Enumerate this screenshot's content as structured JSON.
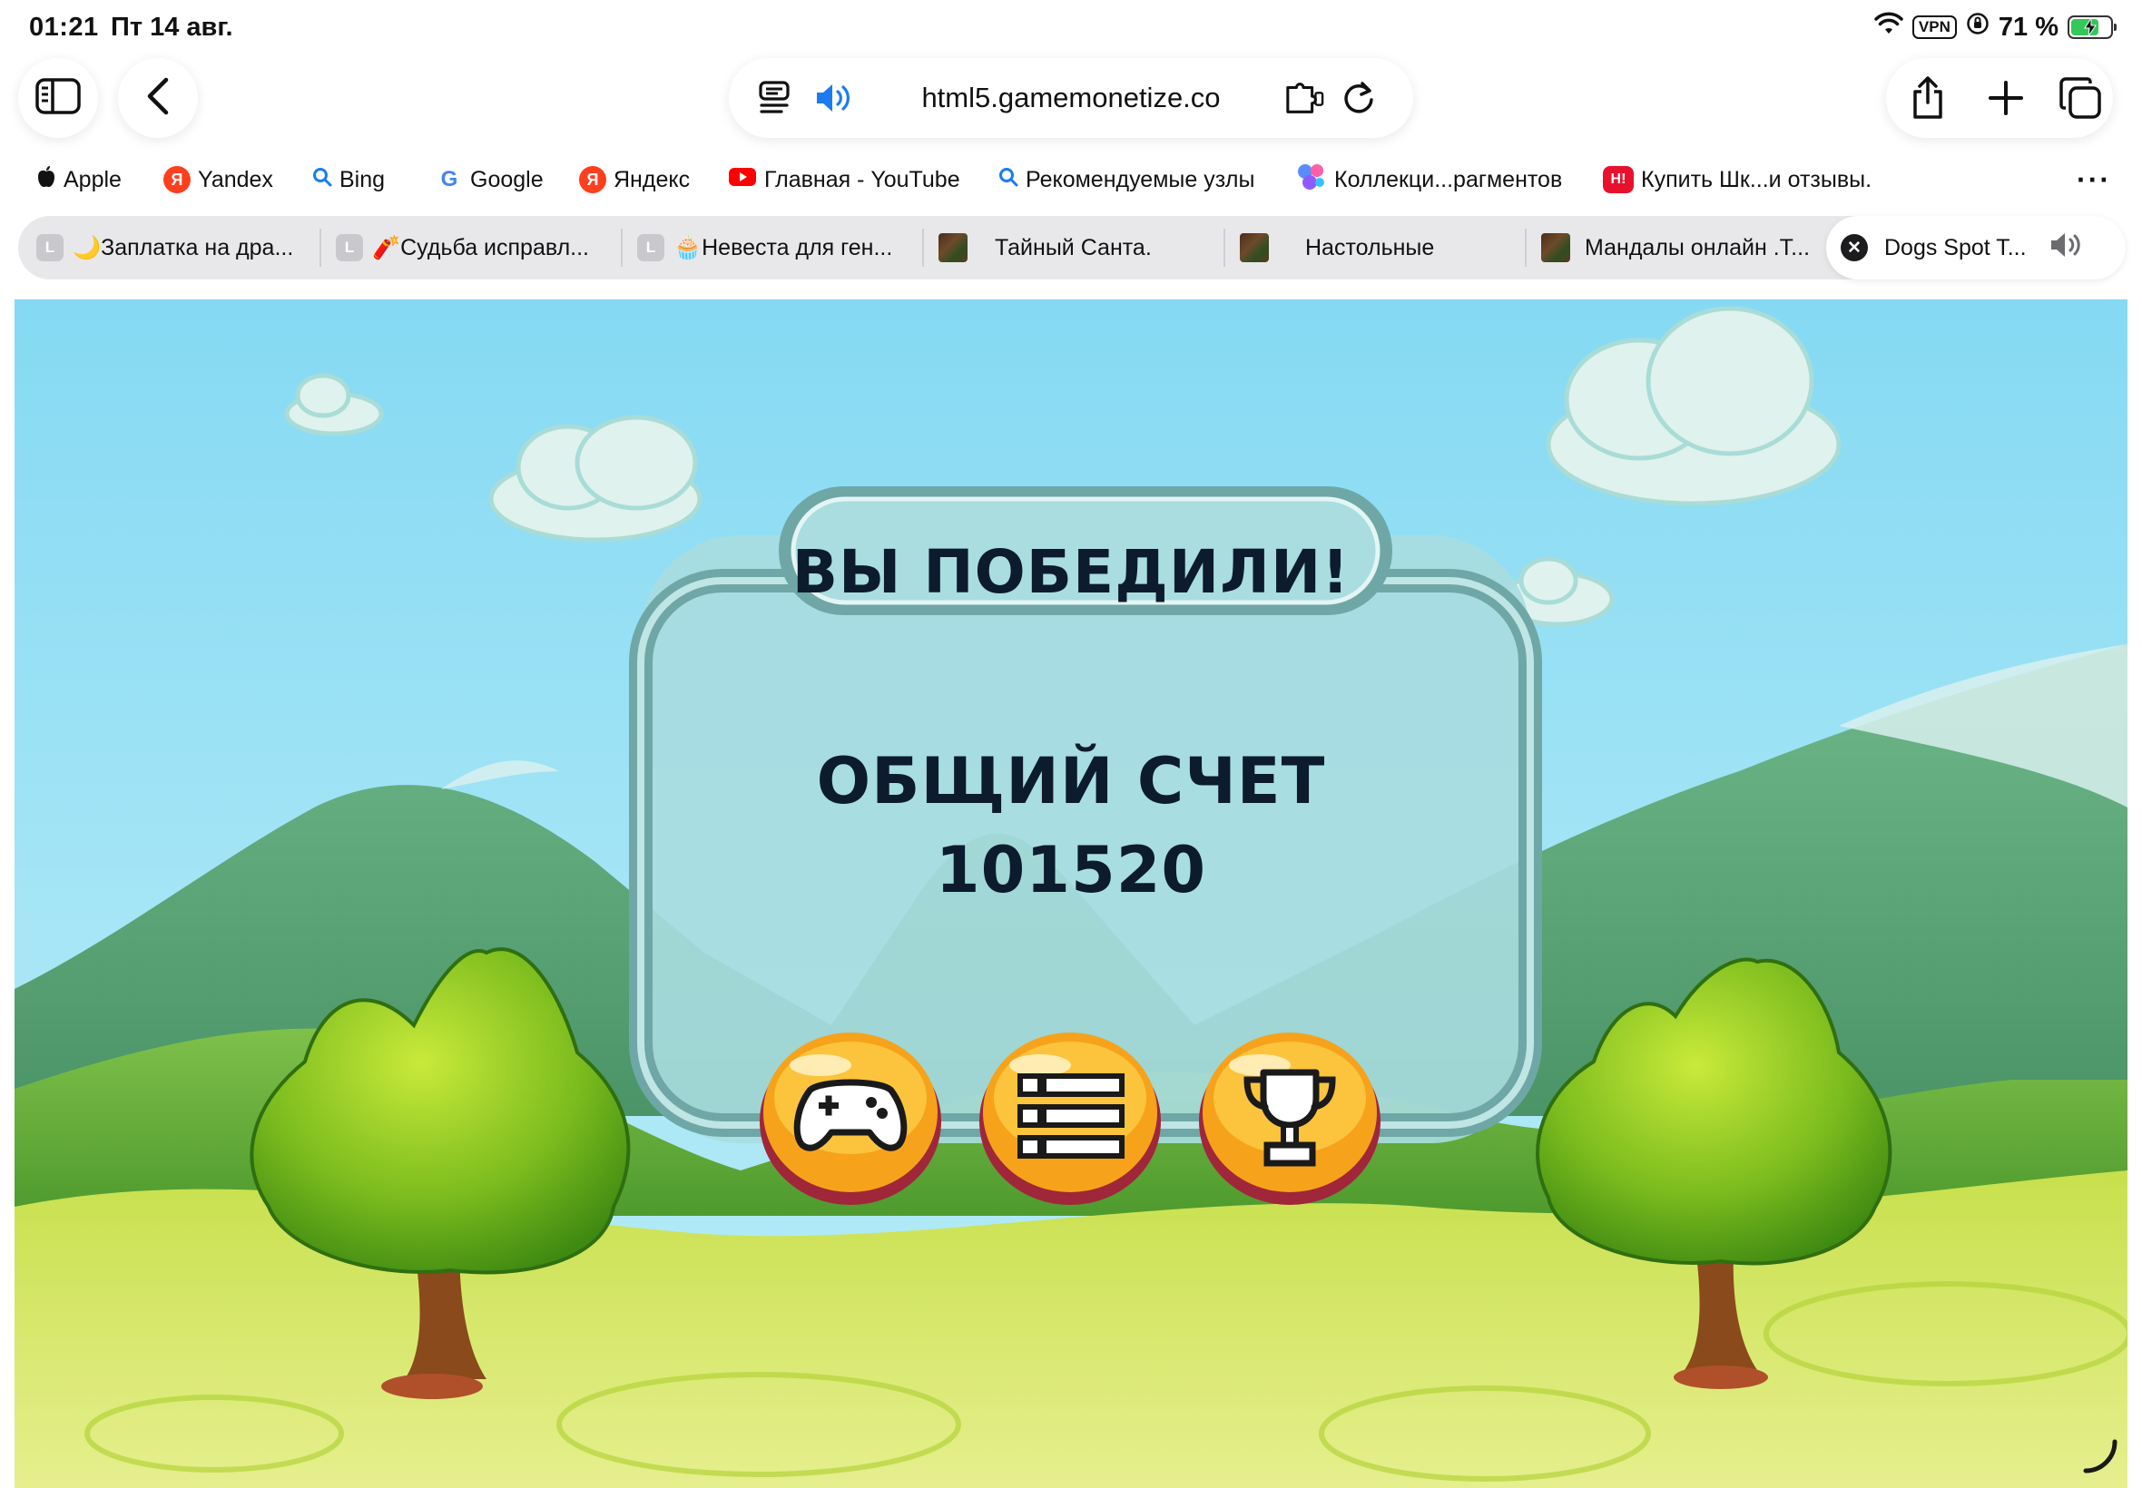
{
  "status_bar": {
    "time": "01:21",
    "date": "Пт 14 авг.",
    "vpn": "VPN",
    "battery": "71 %",
    "battery_level": 0.71,
    "icons": [
      "wifi-icon",
      "vpn-icon",
      "orientation-lock-icon",
      "battery-charging-icon"
    ]
  },
  "toolbar": {
    "url": "html5.gamemonetize.co",
    "icons": [
      "sidebar-icon",
      "back-icon",
      "reader-icon",
      "speaker-icon",
      "extension-icon",
      "reload-icon",
      "share-icon",
      "plus-icon",
      "tabs-icon"
    ]
  },
  "favorites": [
    {
      "label": "Apple",
      "icon": "apple-icon"
    },
    {
      "label": "Yandex",
      "icon": "yandex-icon",
      "glyph": "Я"
    },
    {
      "label": "Bing",
      "icon": "search-icon"
    },
    {
      "label": "Google",
      "icon": "google-icon",
      "glyph": "G"
    },
    {
      "label": "Яндекс",
      "icon": "yandex-icon",
      "glyph": "Я"
    },
    {
      "label": "Главная - YouTube",
      "icon": "youtube-icon"
    },
    {
      "label": "Рекомендуемые узлы",
      "icon": "search-icon"
    },
    {
      "label": "Коллекци...рагментов",
      "icon": "collections-icon"
    },
    {
      "label": "Купить Шк...и отзывы.",
      "icon": "shop-icon",
      "glyph": "Н!"
    }
  ],
  "favorites_more": "···",
  "tabs": [
    {
      "title": "🌙Заплатка на дра...",
      "icon_letter": "L"
    },
    {
      "title": "🧨Судьба исправл...",
      "icon_letter": "L"
    },
    {
      "title": "🧁Невеста для ген...",
      "icon_letter": "L"
    },
    {
      "title": "Тайный Санта.",
      "icon": "thumbnail"
    },
    {
      "title": "Настольные",
      "icon": "thumbnail"
    },
    {
      "title": "Мандалы онлайн .Т...",
      "icon": "thumbnail"
    },
    {
      "title": "Dogs Spot T...",
      "active": true,
      "close_glyph": "✕"
    }
  ],
  "game": {
    "title": "ВЫ ПОБЕДИЛИ!",
    "score_label": "ОБЩИЙ СЧЕТ",
    "score_value": "101520",
    "buttons": [
      {
        "name": "play-again",
        "icon": "gamepad-icon"
      },
      {
        "name": "level-menu",
        "icon": "list-icon"
      },
      {
        "name": "leaderboard",
        "icon": "trophy-icon"
      }
    ],
    "colors": {
      "sky": "#85d9f3",
      "panel": "#a9dde0",
      "panel_frame": "#6fa7a6",
      "button_orange": "#f7a21b",
      "button_rim": "#a0263a",
      "text_dark": "#0d1b2e"
    }
  }
}
